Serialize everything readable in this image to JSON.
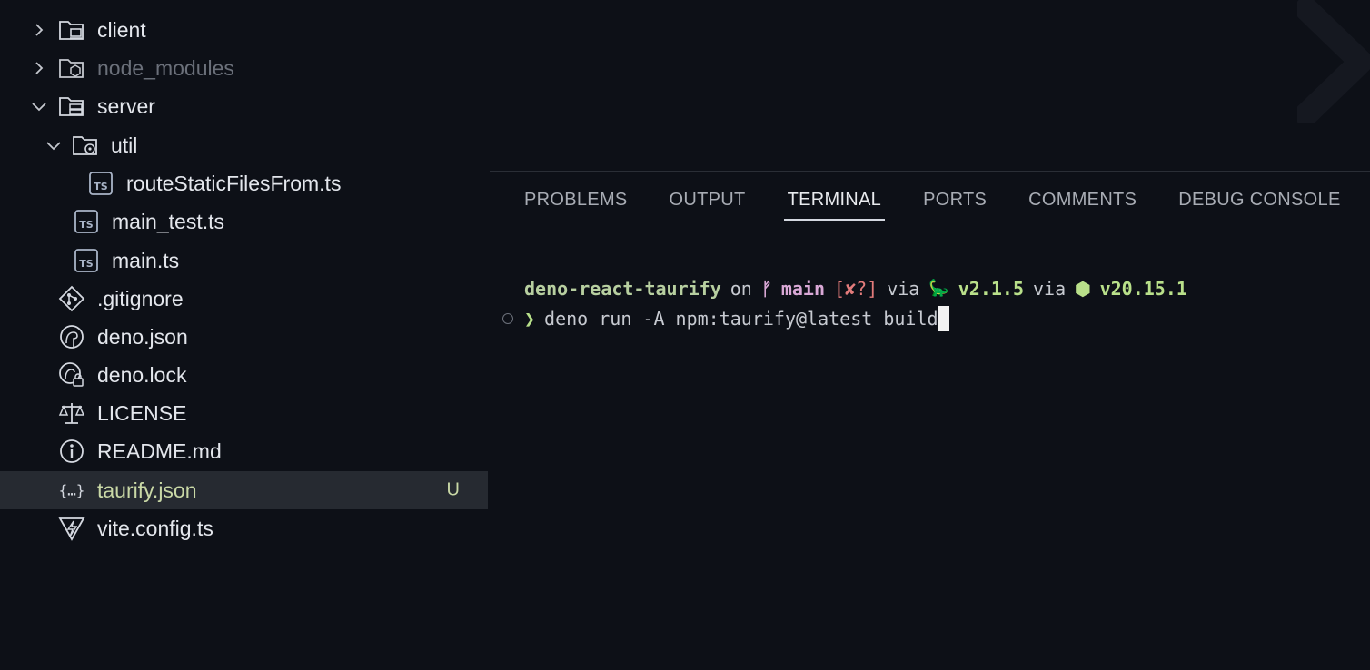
{
  "explorer": {
    "items": [
      {
        "label": "client",
        "kind": "folder",
        "icon": "folder-client-icon",
        "expanded": false
      },
      {
        "label": "node_modules",
        "kind": "folder",
        "icon": "folder-node-icon",
        "expanded": false
      },
      {
        "label": "server",
        "kind": "folder",
        "icon": "folder-server-icon",
        "expanded": true
      },
      {
        "label": "util",
        "kind": "folder",
        "icon": "folder-util-icon",
        "expanded": true
      },
      {
        "label": "routeStaticFilesFrom.ts",
        "kind": "file",
        "icon": "typescript-icon"
      },
      {
        "label": "main_test.ts",
        "kind": "file",
        "icon": "typescript-icon"
      },
      {
        "label": "main.ts",
        "kind": "file",
        "icon": "typescript-icon"
      },
      {
        "label": ".gitignore",
        "kind": "file",
        "icon": "git-icon"
      },
      {
        "label": "deno.json",
        "kind": "file",
        "icon": "deno-icon"
      },
      {
        "label": "deno.lock",
        "kind": "file",
        "icon": "deno-lock-icon"
      },
      {
        "label": "LICENSE",
        "kind": "file",
        "icon": "license-scale-icon"
      },
      {
        "label": "README.md",
        "kind": "file",
        "icon": "info-icon"
      },
      {
        "label": "taurify.json",
        "kind": "file",
        "icon": "json-braces-icon",
        "badge": "U",
        "selected": true
      },
      {
        "label": "vite.config.ts",
        "kind": "file",
        "icon": "vite-icon"
      }
    ]
  },
  "panel": {
    "tabs": [
      {
        "label": "PROBLEMS"
      },
      {
        "label": "OUTPUT"
      },
      {
        "label": "TERMINAL",
        "active": true
      },
      {
        "label": "PORTS"
      },
      {
        "label": "COMMENTS"
      },
      {
        "label": "DEBUG CONSOLE"
      }
    ]
  },
  "terminal": {
    "prompt": {
      "dir": "deno-react-taurify",
      "on": "on",
      "branch_icon": "ᚠ",
      "branch": "main",
      "status": "[✘?]",
      "via1": "via",
      "deno_icon": "🦕",
      "deno_version": "v2.1.5",
      "via2": "via",
      "node_icon": "⬢",
      "node_version": "v20.15.1"
    },
    "arrow": "❯",
    "command": "deno run -A npm:taurify@latest build"
  },
  "colors": {
    "background": "#0d1017",
    "selected_row": "#262a31",
    "modified": "#c9d8a6",
    "prompt_dir": "#b7cfa0",
    "branch": "#d9a8d6",
    "status": "#e27b7b",
    "version": "#b9e08a"
  }
}
